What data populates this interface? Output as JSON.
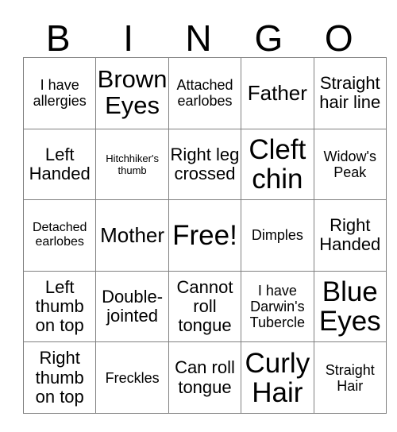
{
  "card": {
    "title": "BINGO",
    "header_letters": [
      "B",
      "I",
      "N",
      "G",
      "O"
    ],
    "free_space_label": "Free!",
    "colors": {
      "text": "#000000",
      "grid_line": "#808080",
      "background": "#ffffff"
    },
    "grid": {
      "columns": 5,
      "rows": 5,
      "cells": [
        [
          {
            "text": "I have allergies",
            "size": "sm"
          },
          {
            "text": "Brown Eyes",
            "size": "xl"
          },
          {
            "text": "Attached earlobes",
            "size": "sm"
          },
          {
            "text": "Father",
            "size": "lg"
          },
          {
            "text": "Straight hair line",
            "size": "md"
          }
        ],
        [
          {
            "text": "Left Handed",
            "size": "md"
          },
          {
            "text": "Hitchhiker's thumb",
            "size": "xxs"
          },
          {
            "text": "Right leg crossed",
            "size": "md"
          },
          {
            "text": "Cleft chin",
            "size": "xxl"
          },
          {
            "text": "Widow's Peak",
            "size": "sm"
          }
        ],
        [
          {
            "text": "Detached earlobes",
            "size": "xs"
          },
          {
            "text": "Mother",
            "size": "lg"
          },
          {
            "text": "Free!",
            "size": "xxl"
          },
          {
            "text": "Dimples",
            "size": "sm"
          },
          {
            "text": "Right Handed",
            "size": "md"
          }
        ],
        [
          {
            "text": "Left thumb on top",
            "size": "md"
          },
          {
            "text": "Double-jointed",
            "size": "md"
          },
          {
            "text": "Cannot roll tongue",
            "size": "md"
          },
          {
            "text": "I have Darwin's Tubercle",
            "size": "sm"
          },
          {
            "text": "Blue Eyes",
            "size": "xxl"
          }
        ],
        [
          {
            "text": "Right thumb on top",
            "size": "md"
          },
          {
            "text": "Freckles",
            "size": "sm"
          },
          {
            "text": "Can roll tongue",
            "size": "md"
          },
          {
            "text": "Curly Hair",
            "size": "xxl"
          },
          {
            "text": "Straight Hair",
            "size": "sm"
          }
        ]
      ]
    }
  }
}
